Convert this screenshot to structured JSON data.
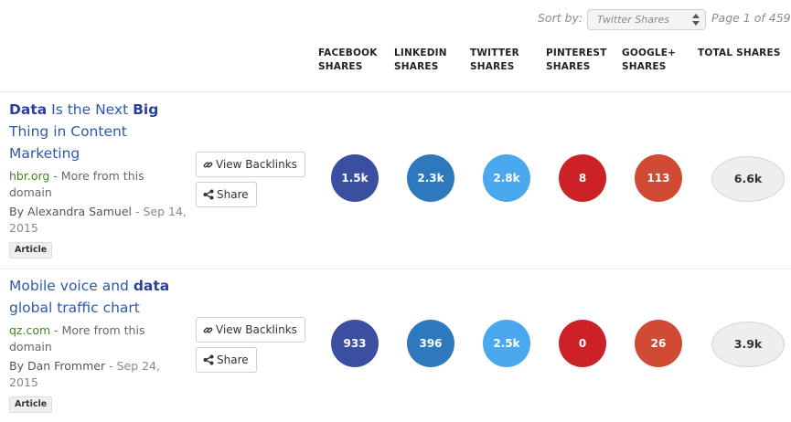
{
  "sort": {
    "label": "Sort by:",
    "selected": "Twitter Shares",
    "page_info": "Page 1 of 459"
  },
  "columns": {
    "facebook": [
      "FACEBOOK",
      "SHARES"
    ],
    "linkedin": [
      "LINKEDIN",
      "SHARES"
    ],
    "twitter": [
      "TWITTER",
      "SHARES"
    ],
    "pinterest": [
      "PINTEREST",
      "SHARES"
    ],
    "googleplus": [
      "GOOGLE+",
      "SHARES"
    ],
    "total": [
      "TOTAL SHARES"
    ]
  },
  "colors": {
    "facebook": "#3b4fa0",
    "linkedin": "#2e79bd",
    "twitter": "#4aa8ee",
    "pinterest": "#cc2127",
    "googleplus": "#d04a34",
    "title_link": "#2f5aa8",
    "domain": "#3e8a1e"
  },
  "buttons": {
    "backlinks": "View Backlinks",
    "share": "Share"
  },
  "articles": [
    {
      "title_parts": [
        {
          "text": "Data",
          "bold": true
        },
        {
          "text": " Is the Next ",
          "bold": false
        },
        {
          "text": "Big",
          "bold": true
        },
        {
          "text": " Thing in Content Marketing",
          "bold": false
        }
      ],
      "domain": "hbr.org",
      "more": " - More from this domain",
      "author": "By Alexandra Samuel",
      "date": " - Sep 14, 2015",
      "tag": "Article",
      "facebook": "1.5k",
      "linkedin": "2.3k",
      "twitter": "2.8k",
      "pinterest": "8",
      "googleplus": "113",
      "total": "6.6k"
    },
    {
      "title_parts": [
        {
          "text": "Mobile voice and ",
          "bold": false
        },
        {
          "text": "data",
          "bold": true
        },
        {
          "text": " global traffic chart",
          "bold": false
        }
      ],
      "domain": "qz.com",
      "more": " - More from this domain",
      "author": "By Dan Frommer",
      "date": " - Sep 24, 2015",
      "tag": "Article",
      "facebook": "933",
      "linkedin": "396",
      "twitter": "2.5k",
      "pinterest": "0",
      "googleplus": "26",
      "total": "3.9k"
    }
  ]
}
